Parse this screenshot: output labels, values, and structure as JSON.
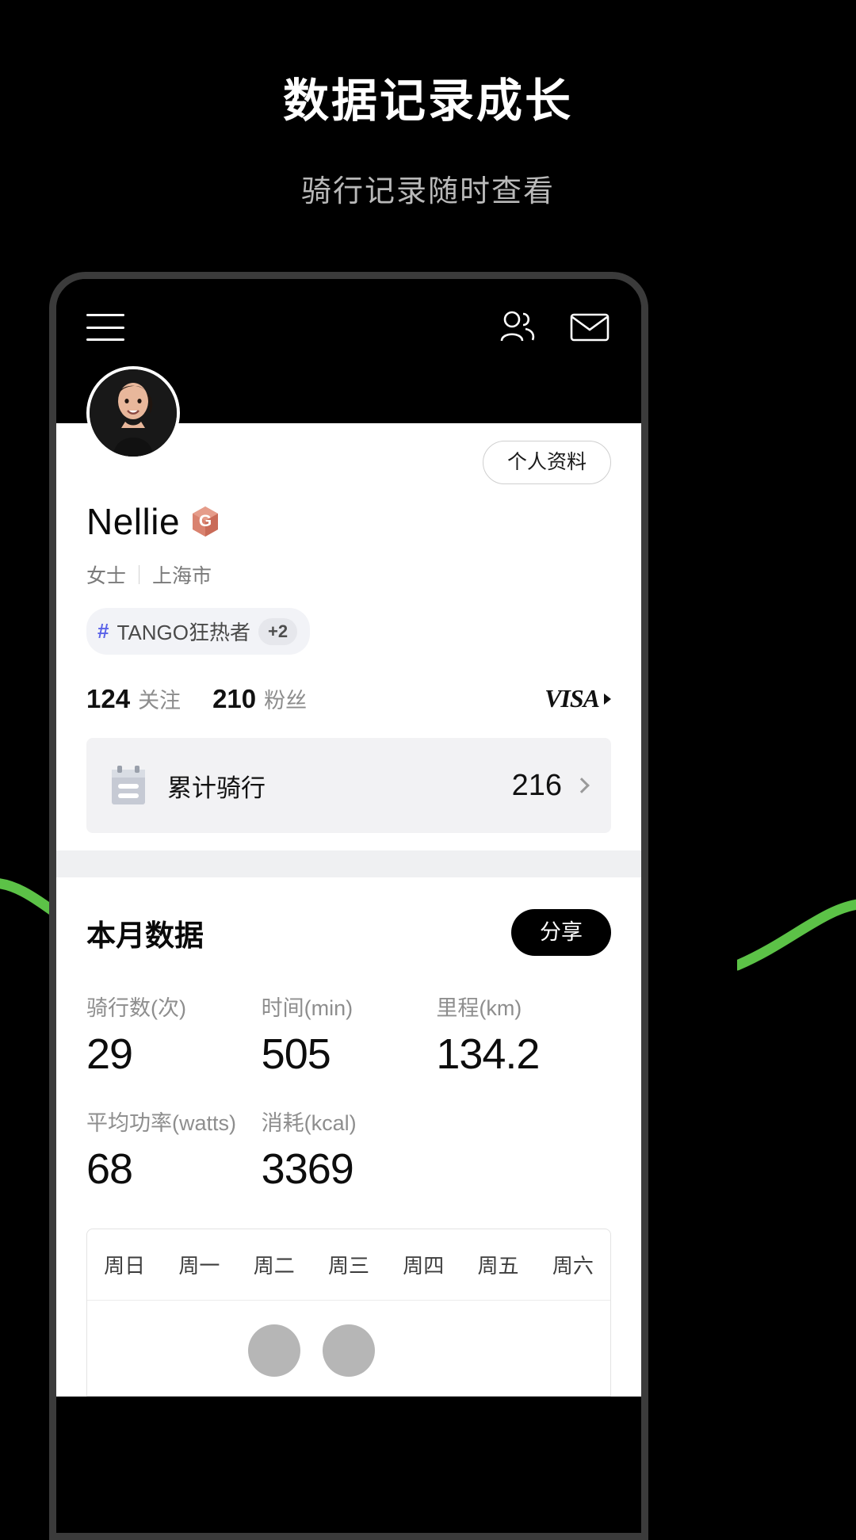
{
  "promo": {
    "title": "数据记录成长",
    "subtitle": "骑行记录随时查看"
  },
  "colors": {
    "page_bg": "#000000",
    "phone_frame": "#3b3b3b",
    "accent_green": "#5cc247",
    "chip_bg": "#f2f3f7",
    "chip_hash": "#5b63e8",
    "badge": "#d98070",
    "card_bg": "#f2f2f4",
    "share_btn_bg": "#000000"
  },
  "header": {
    "menu_icon": "hamburger-icon",
    "friends_icon": "friends-icon",
    "mail_icon": "mail-icon"
  },
  "profile": {
    "avatar_alt": "user-avatar",
    "profile_button": "个人资料",
    "name": "Nellie",
    "badge_letter": "G",
    "gender": "女士",
    "city": "上海市",
    "tag": {
      "hash": "#",
      "label": "TANGO狂热者",
      "more": "+2"
    },
    "following_count": "124",
    "following_label": "关注",
    "followers_count": "210",
    "followers_label": "粉丝",
    "card_brand": "VISA"
  },
  "total_ride": {
    "icon": "calendar-icon",
    "label": "累计骑行",
    "value": "216",
    "chevron": "chevron-right-icon"
  },
  "month": {
    "title": "本月数据",
    "share_label": "分享",
    "metrics": [
      {
        "label": "骑行数(次)",
        "value": "29"
      },
      {
        "label": "时间(min)",
        "value": "505"
      },
      {
        "label": "里程(km)",
        "value": "134.2"
      },
      {
        "label": "平均功率(watts)",
        "value": "68"
      },
      {
        "label": "消耗(kcal)",
        "value": "3369"
      }
    ]
  },
  "chart_data": {
    "type": "bar",
    "title": "本月数据",
    "categories": [
      "周日",
      "周一",
      "周二",
      "周三",
      "周四",
      "周五",
      "周六"
    ],
    "values": [
      0,
      0,
      1,
      1,
      0,
      0,
      0
    ],
    "xlabel": "",
    "ylabel": "",
    "legend": []
  }
}
